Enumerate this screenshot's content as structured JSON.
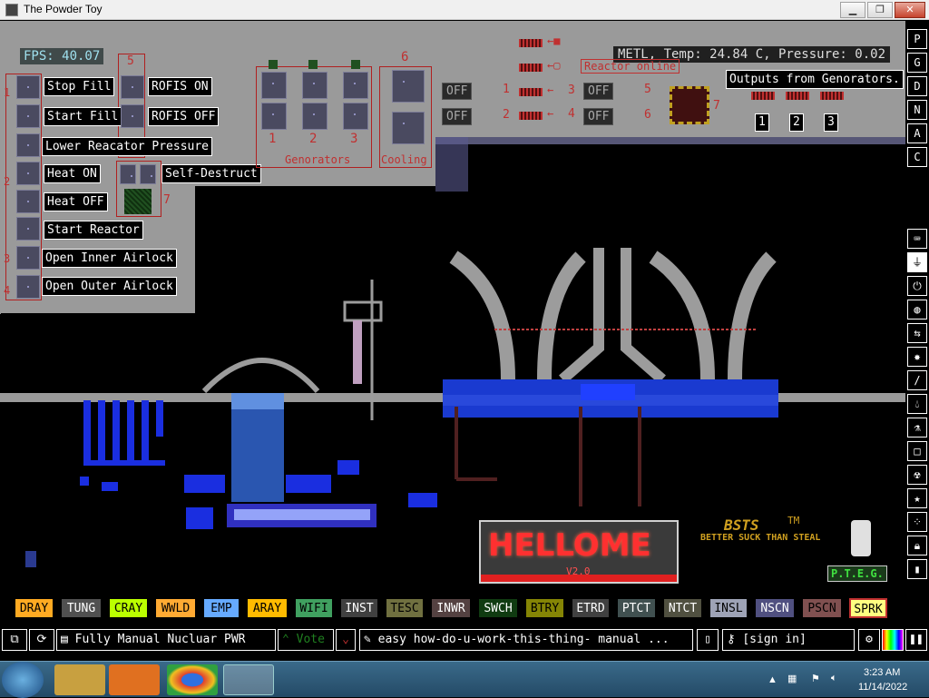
{
  "window": {
    "title": "The Powder Toy",
    "minimize": "▁",
    "maximize": "❐",
    "close": "✕"
  },
  "hud": {
    "fps": "FPS: 40.07",
    "status": "METL, Temp: 24.84 C, Pressure: 0.02"
  },
  "controls": {
    "stop_fill": "Stop Fill",
    "start_fill": "Start Fill",
    "rofis_on": "ROFIS ON",
    "rofis_off": "ROFIS OFF",
    "lower_pressure": "Lower Reacator Pressure",
    "heat_on": "Heat ON",
    "heat_off": "Heat OFF",
    "self_destruct": "Self-Destruct",
    "start_reactor": "Start Reactor",
    "open_inner": "Open Inner Airlock",
    "open_outer": "Open Outer Airlock",
    "num_1": "1",
    "num_2": "2",
    "num_3": "3",
    "num_4": "4",
    "num_5": "5",
    "num_6": "6",
    "num_7": "7"
  },
  "generators": {
    "label": "Genorators",
    "cooling": "Cooling",
    "g1": "1",
    "g2": "2",
    "g3": "3",
    "n6": "6"
  },
  "outputs": {
    "title": "Outputs from Genorators.",
    "off": "OFF",
    "reactor_online": "Reactor online",
    "o1": "1",
    "o2": "2",
    "o3": "3",
    "n5": "5",
    "n6": "6",
    "n7": "7"
  },
  "arrows": {
    "a1": "1",
    "a2": "2",
    "a3": "3",
    "a4": "4"
  },
  "logos": {
    "hellome": "HELLOME",
    "version": "V2.0",
    "bsts": "BSTS",
    "tm": "TM",
    "tagline": "BETTER SUCK THAN STEAL",
    "pteg": "P.T.E.G."
  },
  "sidebar": [
    "P",
    "G",
    "D",
    "N",
    "A",
    "C"
  ],
  "tools": [
    "keyboard-icon",
    "plug-icon",
    "power-icon",
    "sensor-icon",
    "arrows-icon",
    "explosive-icon",
    "wand-icon",
    "drop-icon",
    "flask-icon",
    "square-icon",
    "radioactive-icon",
    "star-icon",
    "dots-icon",
    "lock-icon",
    "bookmark-icon"
  ],
  "elements": [
    {
      "name": "DRAY",
      "bg": "#ffaa22",
      "fg": "#000"
    },
    {
      "name": "TUNG",
      "bg": "#505050",
      "fg": "#fff"
    },
    {
      "name": "CRAY",
      "bg": "#bbff00",
      "fg": "#000"
    },
    {
      "name": "WWLD",
      "bg": "#ffaa33",
      "fg": "#000"
    },
    {
      "name": "EMP",
      "bg": "#66aaff",
      "fg": "#000"
    },
    {
      "name": "ARAY",
      "bg": "#ffbb00",
      "fg": "#000"
    },
    {
      "name": "WIFI",
      "bg": "#40a060",
      "fg": "#000"
    },
    {
      "name": "INST",
      "bg": "#404040",
      "fg": "#fff"
    },
    {
      "name": "TESC",
      "bg": "#707040",
      "fg": "#000"
    },
    {
      "name": "INWR",
      "bg": "#544141",
      "fg": "#fff"
    },
    {
      "name": "SWCH",
      "bg": "#103b11",
      "fg": "#fff"
    },
    {
      "name": "BTRY",
      "bg": "#858505",
      "fg": "#000"
    },
    {
      "name": "ETRD",
      "bg": "#404040",
      "fg": "#fff"
    },
    {
      "name": "PTCT",
      "bg": "#405050",
      "fg": "#fff"
    },
    {
      "name": "NTCT",
      "bg": "#505040",
      "fg": "#fff"
    },
    {
      "name": "INSL",
      "bg": "#9ea3b6",
      "fg": "#000"
    },
    {
      "name": "NSCN",
      "bg": "#505080",
      "fg": "#fff"
    },
    {
      "name": "PSCN",
      "bg": "#805050",
      "fg": "#000"
    },
    {
      "name": "SPRK",
      "bg": "#ffff80",
      "fg": "#000"
    }
  ],
  "bottom": {
    "save_name": "Fully Manual Nucluar PWR",
    "vote": "Vote",
    "tags": "easy how-do-u-work-this-thing- manual ...",
    "sign_in": "[sign in]"
  },
  "taskbar": {
    "time": "3:23 AM",
    "date": "11/14/2022"
  },
  "colors": {
    "accent_red": "#b02020",
    "liquid_blue": "#1a3ad0",
    "metal_grey": "#9c9c9c"
  }
}
